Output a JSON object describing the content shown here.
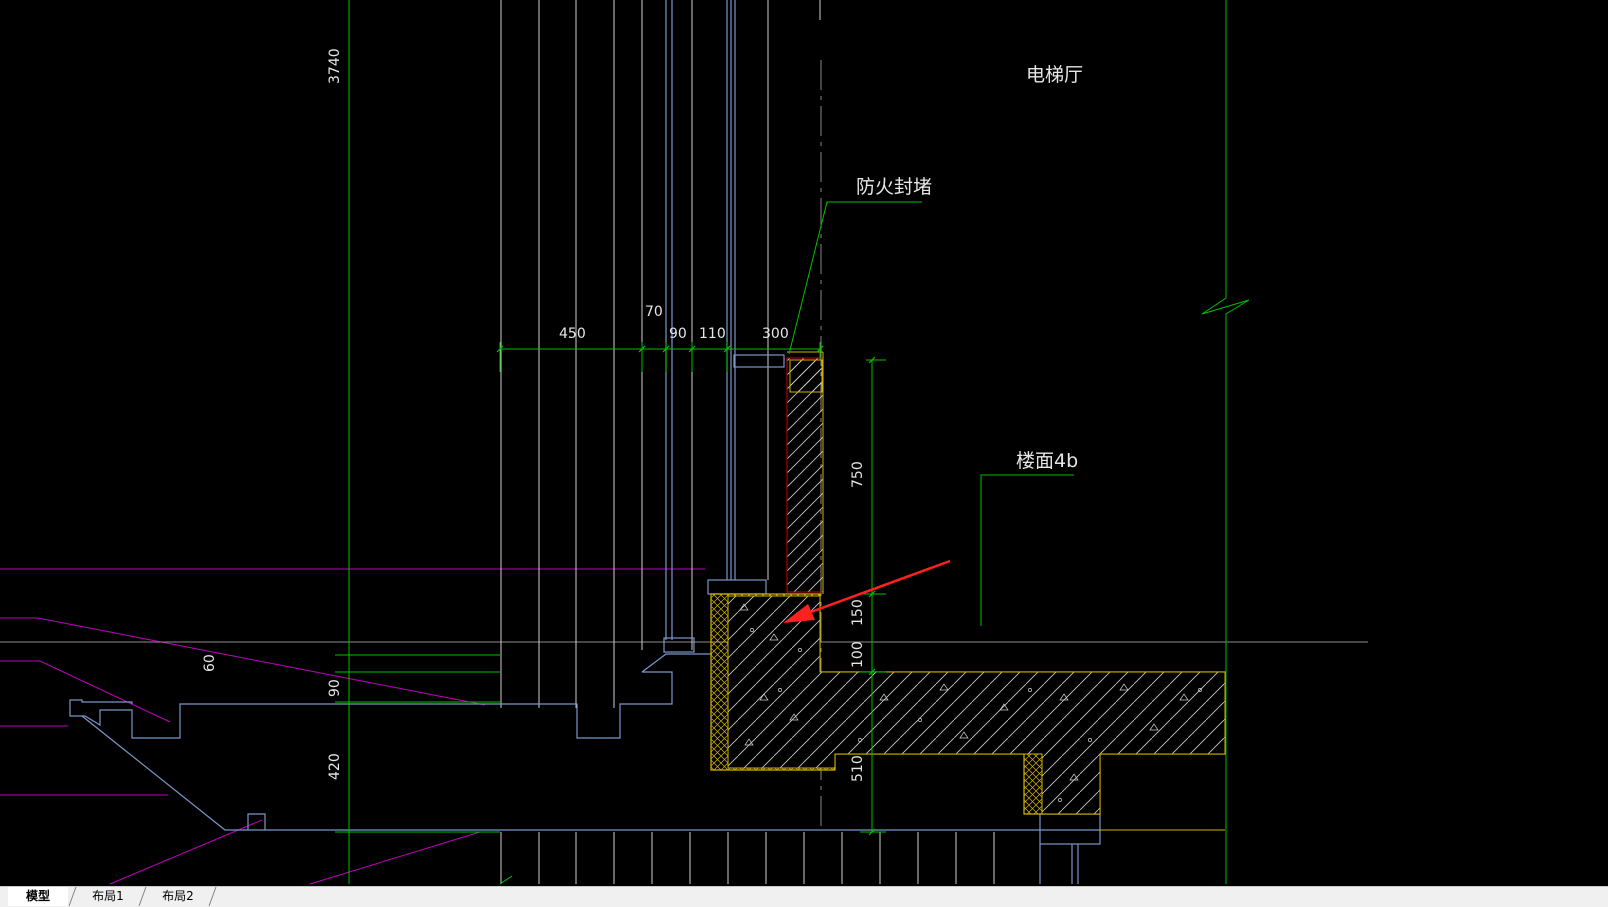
{
  "drawing": {
    "room_label": "电梯厅",
    "callouts": {
      "firestop": "防火封堵",
      "floor_finish": "楼面4b"
    },
    "dimensions": {
      "top_vertical": "3740",
      "horizontal": [
        "450",
        "70",
        "90",
        "110",
        "300"
      ],
      "right_vertical": [
        "750",
        "150",
        "100",
        "510"
      ],
      "left_vertical": [
        "60",
        "90",
        "420"
      ]
    },
    "colors": {
      "background": "#000000",
      "grid_green": "#00c000",
      "outline_blue": "#7a96c8",
      "hatch_yellow": "#d2b400",
      "magenta": "#c000c0",
      "red": "#d20000",
      "arrow_red": "#ff2020",
      "white_line": "#cfcfcf",
      "gray_axis": "#8c8c8c"
    }
  },
  "tabs": [
    {
      "label": "模型",
      "active": true
    },
    {
      "label": "布局1",
      "active": false
    },
    {
      "label": "布局2",
      "active": false
    }
  ]
}
